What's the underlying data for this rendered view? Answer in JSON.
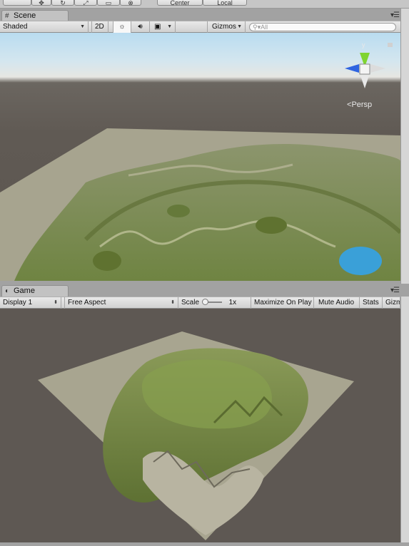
{
  "scene": {
    "tab_label": "Scene",
    "shading_mode": "Shaded",
    "mode_2d_label": "2D",
    "gizmos_label": "Gizmos",
    "search_placeholder": "All",
    "projection_label": "Persp",
    "gizmo_axis_y": "y"
  },
  "game": {
    "tab_label": "Game",
    "display": "Display 1",
    "aspect": "Free Aspect",
    "scale_label": "Scale",
    "scale_value": "1x",
    "maximize_label": "Maximize On Play",
    "mute_label": "Mute Audio",
    "stats_label": "Stats",
    "gizmos_label": "Gizm"
  },
  "top_toolbar": {
    "pivot_label": "Center",
    "space_label": "Local"
  },
  "colors": {
    "terrain_grass": "#7a8f48",
    "terrain_rock": "#a9a48e",
    "water": "#3aa0d8",
    "gizmo_y": "#7fd430",
    "gizmo_x": "#2f64e0"
  },
  "icons": [
    "move-icon",
    "rotate-icon",
    "scale-icon",
    "rect-icon",
    "transform-icon",
    "sun-icon",
    "audio-icon",
    "image-effects-icon",
    "scene-tab-icon",
    "game-tab-icon",
    "search-icon",
    "tab-menu-icon"
  ]
}
